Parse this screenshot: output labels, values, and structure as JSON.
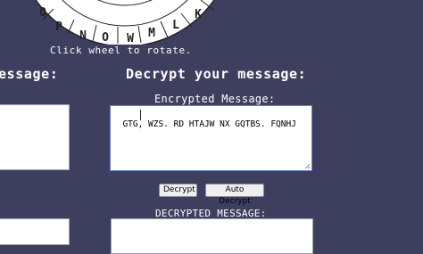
{
  "wheel": {
    "letters": [
      "D",
      "O",
      "P",
      "N",
      "O",
      "W",
      "M",
      "L",
      "K"
    ]
  },
  "hint": "Click wheel to rotate.",
  "encrypt_section": {
    "heading": "essage:"
  },
  "decrypt_section": {
    "heading": "Decrypt your message:",
    "encrypted_label": "Encrypted Message:",
    "encrypted_value": "GTG, WZS. RD HTAJW NX GQTBS. FQNHJ",
    "decrypt_button": "Decrypt",
    "auto_decrypt_button": "Auto Decrypt",
    "decrypted_label": "DECRYPTED MESSAGE:",
    "decrypted_value": ""
  }
}
